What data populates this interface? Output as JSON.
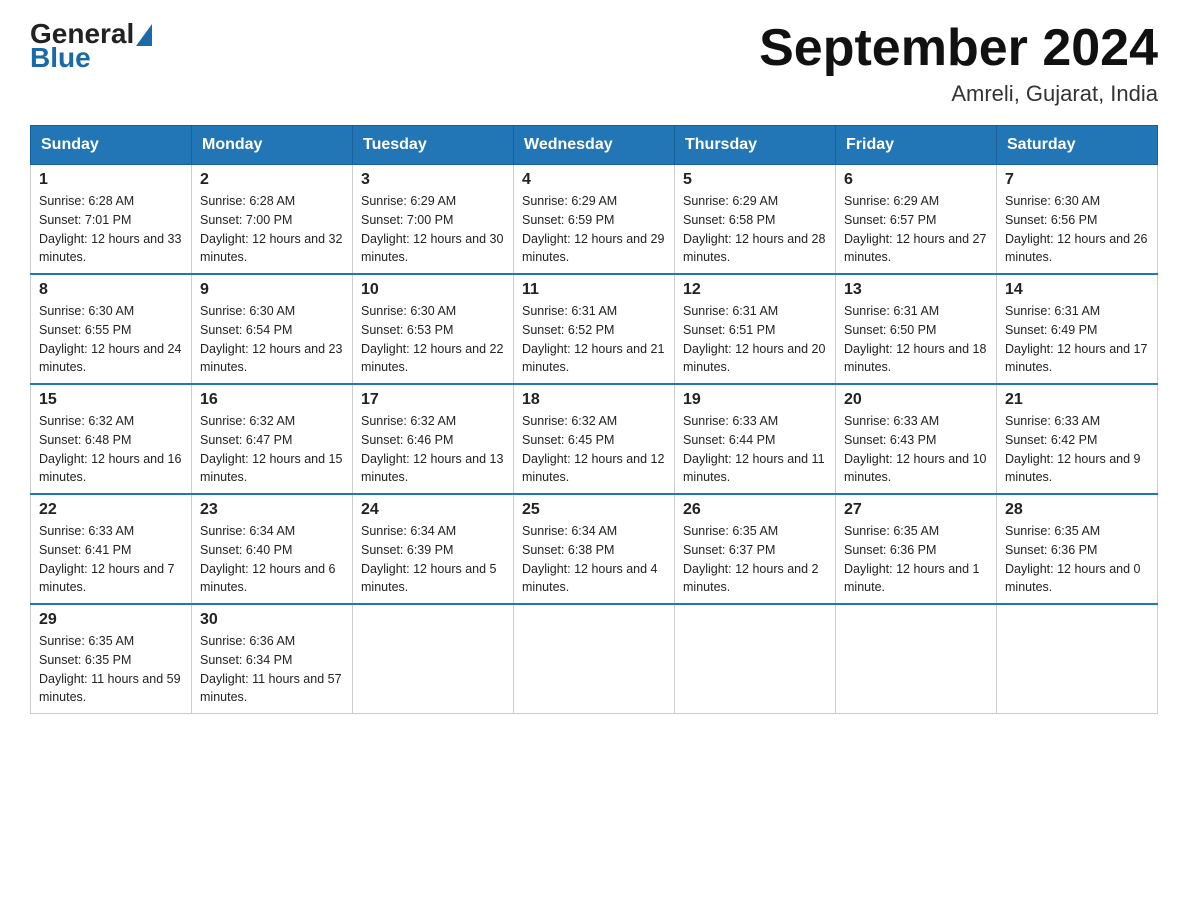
{
  "logo": {
    "general": "General",
    "blue": "Blue"
  },
  "title": "September 2024",
  "subtitle": "Amreli, Gujarat, India",
  "days_of_week": [
    "Sunday",
    "Monday",
    "Tuesday",
    "Wednesday",
    "Thursday",
    "Friday",
    "Saturday"
  ],
  "weeks": [
    [
      {
        "day": "1",
        "sunrise": "6:28 AM",
        "sunset": "7:01 PM",
        "daylight": "12 hours and 33 minutes."
      },
      {
        "day": "2",
        "sunrise": "6:28 AM",
        "sunset": "7:00 PM",
        "daylight": "12 hours and 32 minutes."
      },
      {
        "day": "3",
        "sunrise": "6:29 AM",
        "sunset": "7:00 PM",
        "daylight": "12 hours and 30 minutes."
      },
      {
        "day": "4",
        "sunrise": "6:29 AM",
        "sunset": "6:59 PM",
        "daylight": "12 hours and 29 minutes."
      },
      {
        "day": "5",
        "sunrise": "6:29 AM",
        "sunset": "6:58 PM",
        "daylight": "12 hours and 28 minutes."
      },
      {
        "day": "6",
        "sunrise": "6:29 AM",
        "sunset": "6:57 PM",
        "daylight": "12 hours and 27 minutes."
      },
      {
        "day": "7",
        "sunrise": "6:30 AM",
        "sunset": "6:56 PM",
        "daylight": "12 hours and 26 minutes."
      }
    ],
    [
      {
        "day": "8",
        "sunrise": "6:30 AM",
        "sunset": "6:55 PM",
        "daylight": "12 hours and 24 minutes."
      },
      {
        "day": "9",
        "sunrise": "6:30 AM",
        "sunset": "6:54 PM",
        "daylight": "12 hours and 23 minutes."
      },
      {
        "day": "10",
        "sunrise": "6:30 AM",
        "sunset": "6:53 PM",
        "daylight": "12 hours and 22 minutes."
      },
      {
        "day": "11",
        "sunrise": "6:31 AM",
        "sunset": "6:52 PM",
        "daylight": "12 hours and 21 minutes."
      },
      {
        "day": "12",
        "sunrise": "6:31 AM",
        "sunset": "6:51 PM",
        "daylight": "12 hours and 20 minutes."
      },
      {
        "day": "13",
        "sunrise": "6:31 AM",
        "sunset": "6:50 PM",
        "daylight": "12 hours and 18 minutes."
      },
      {
        "day": "14",
        "sunrise": "6:31 AM",
        "sunset": "6:49 PM",
        "daylight": "12 hours and 17 minutes."
      }
    ],
    [
      {
        "day": "15",
        "sunrise": "6:32 AM",
        "sunset": "6:48 PM",
        "daylight": "12 hours and 16 minutes."
      },
      {
        "day": "16",
        "sunrise": "6:32 AM",
        "sunset": "6:47 PM",
        "daylight": "12 hours and 15 minutes."
      },
      {
        "day": "17",
        "sunrise": "6:32 AM",
        "sunset": "6:46 PM",
        "daylight": "12 hours and 13 minutes."
      },
      {
        "day": "18",
        "sunrise": "6:32 AM",
        "sunset": "6:45 PM",
        "daylight": "12 hours and 12 minutes."
      },
      {
        "day": "19",
        "sunrise": "6:33 AM",
        "sunset": "6:44 PM",
        "daylight": "12 hours and 11 minutes."
      },
      {
        "day": "20",
        "sunrise": "6:33 AM",
        "sunset": "6:43 PM",
        "daylight": "12 hours and 10 minutes."
      },
      {
        "day": "21",
        "sunrise": "6:33 AM",
        "sunset": "6:42 PM",
        "daylight": "12 hours and 9 minutes."
      }
    ],
    [
      {
        "day": "22",
        "sunrise": "6:33 AM",
        "sunset": "6:41 PM",
        "daylight": "12 hours and 7 minutes."
      },
      {
        "day": "23",
        "sunrise": "6:34 AM",
        "sunset": "6:40 PM",
        "daylight": "12 hours and 6 minutes."
      },
      {
        "day": "24",
        "sunrise": "6:34 AM",
        "sunset": "6:39 PM",
        "daylight": "12 hours and 5 minutes."
      },
      {
        "day": "25",
        "sunrise": "6:34 AM",
        "sunset": "6:38 PM",
        "daylight": "12 hours and 4 minutes."
      },
      {
        "day": "26",
        "sunrise": "6:35 AM",
        "sunset": "6:37 PM",
        "daylight": "12 hours and 2 minutes."
      },
      {
        "day": "27",
        "sunrise": "6:35 AM",
        "sunset": "6:36 PM",
        "daylight": "12 hours and 1 minute."
      },
      {
        "day": "28",
        "sunrise": "6:35 AM",
        "sunset": "6:36 PM",
        "daylight": "12 hours and 0 minutes."
      }
    ],
    [
      {
        "day": "29",
        "sunrise": "6:35 AM",
        "sunset": "6:35 PM",
        "daylight": "11 hours and 59 minutes."
      },
      {
        "day": "30",
        "sunrise": "6:36 AM",
        "sunset": "6:34 PM",
        "daylight": "11 hours and 57 minutes."
      },
      null,
      null,
      null,
      null,
      null
    ]
  ]
}
